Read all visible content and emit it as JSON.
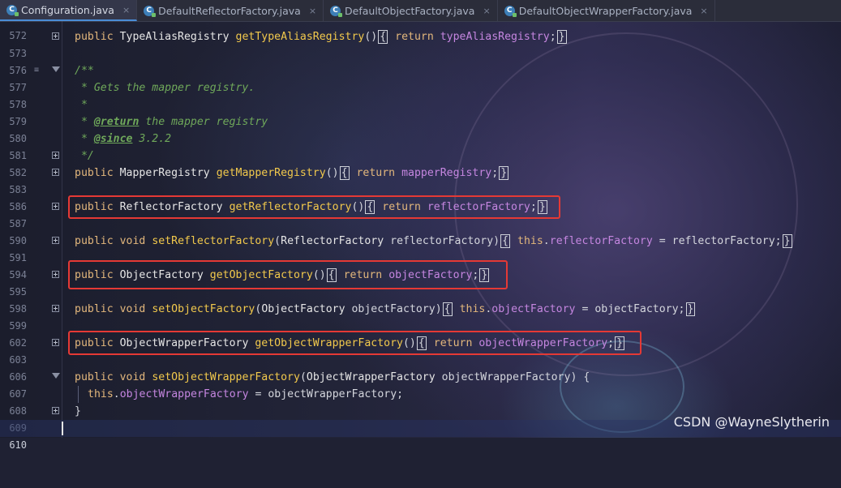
{
  "tabs": [
    {
      "label": "Configuration.java",
      "active": true
    },
    {
      "label": "DefaultReflectorFactory.java",
      "active": false
    },
    {
      "label": "DefaultObjectFactory.java",
      "active": false
    },
    {
      "label": "DefaultObjectWrapperFactory.java",
      "active": false
    }
  ],
  "close_glyph": "×",
  "file_icon": "C",
  "lines": [
    {
      "n": "572"
    },
    {
      "n": "573"
    },
    {
      "n": "576"
    },
    {
      "n": "577"
    },
    {
      "n": "578"
    },
    {
      "n": "579"
    },
    {
      "n": "580"
    },
    {
      "n": "581"
    },
    {
      "n": "582"
    },
    {
      "n": "583"
    },
    {
      "n": "586"
    },
    {
      "n": "587"
    },
    {
      "n": "590"
    },
    {
      "n": "591"
    },
    {
      "n": "594"
    },
    {
      "n": "595"
    },
    {
      "n": "598"
    },
    {
      "n": "599"
    },
    {
      "n": "602"
    },
    {
      "n": "603"
    },
    {
      "n": "606"
    },
    {
      "n": "607"
    },
    {
      "n": "608"
    },
    {
      "n": "609"
    },
    {
      "n": "610"
    }
  ],
  "code": {
    "l573": {
      "kw": "public",
      "type": "TypeAliasRegistry",
      "fn": "getTypeAliasRegistry",
      "ret": "return",
      "fld": "typeAliasRegistry"
    },
    "l577": "/**",
    "l578": " * Gets the mapper registry.",
    "l579": " *",
    "l580_tag": "@return",
    "l580_rest": " the mapper registry",
    "l581_tag": "@since",
    "l581_rest": " 3.2.2",
    "l582": " */",
    "l583": {
      "kw": "public",
      "type": "MapperRegistry",
      "fn": "getMapperRegistry",
      "ret": "return",
      "fld": "mapperRegistry"
    },
    "l587": {
      "kw": "public",
      "type": "ReflectorFactory",
      "fn": "getReflectorFactory",
      "ret": "return",
      "fld": "reflectorFactory"
    },
    "l591": {
      "kw": "public",
      "void": "void",
      "fn": "setReflectorFactory",
      "ptype": "ReflectorFactory",
      "pname": "reflectorFactory",
      "this": "this",
      "fld": "reflectorFactory",
      "rhs": "reflectorFactory"
    },
    "l595": {
      "kw": "public",
      "type": "ObjectFactory",
      "fn": "getObjectFactory",
      "ret": "return",
      "fld": "objectFactory"
    },
    "l599": {
      "kw": "public",
      "void": "void",
      "fn": "setObjectFactory",
      "ptype": "ObjectFactory",
      "pname": "objectFactory",
      "this": "this",
      "fld": "objectFactory",
      "rhs": "objectFactory"
    },
    "l603": {
      "kw": "public",
      "type": "ObjectWrapperFactory",
      "fn": "getObjectWrapperFactory",
      "ret": "return",
      "fld": "objectWrapperFactory"
    },
    "l607": {
      "kw": "public",
      "void": "void",
      "fn": "setObjectWrapperFactory",
      "ptype": "ObjectWrapperFactory",
      "pname": "objectWrapperFactory"
    },
    "l608": {
      "this": "this",
      "fld": "objectWrapperFactory",
      "rhs": "objectWrapperFactory"
    },
    "l609": "}"
  },
  "watermark": "CSDN @WayneSlytherin",
  "highlight_color": "#e53935"
}
